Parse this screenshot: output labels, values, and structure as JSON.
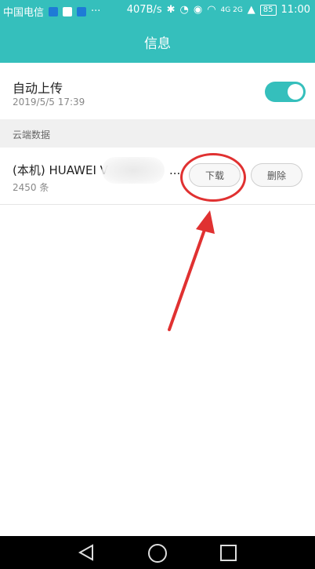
{
  "status_bar": {
    "carrier": "中国电信",
    "speed": "407B/s",
    "signal_type": "4G 2G",
    "battery": "85",
    "time": "11:00",
    "more": "···"
  },
  "header": {
    "title": "信息"
  },
  "auto_upload": {
    "title": "自动上传",
    "timestamp": "2019/5/5 17:39",
    "enabled": true
  },
  "section": {
    "label": "云端数据"
  },
  "device": {
    "name": "(本机) HUAWEI V",
    "name_suffix": "...",
    "count": "2450 条",
    "download_label": "下载",
    "delete_label": "删除"
  },
  "colors": {
    "accent": "#35bfbc",
    "annotation": "#e03131"
  }
}
